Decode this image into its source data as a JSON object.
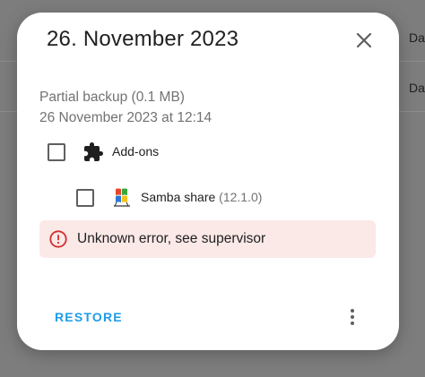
{
  "background": {
    "right_labels": [
      "Da",
      "Da"
    ]
  },
  "dialog": {
    "title": "26. November 2023",
    "backup_type": "Partial backup (0.1 MB)",
    "backup_datetime": "26 November 2023 at 12:14",
    "items": [
      {
        "label": "Add-ons",
        "icon": "puzzle-piece-icon",
        "checked": false
      },
      {
        "label": "Samba share",
        "version": "(12.1.0)",
        "icon": "samba-share-logo-icon",
        "checked": false
      }
    ],
    "error": {
      "icon": "alert-circle-icon",
      "message": "Unknown error, see supervisor",
      "color": "#d32f2f",
      "background": "#fae9e7"
    },
    "actions": {
      "restore_label": "RESTORE",
      "restore_color": "#1e9be8",
      "more_icon": "dots-vertical-icon"
    }
  }
}
